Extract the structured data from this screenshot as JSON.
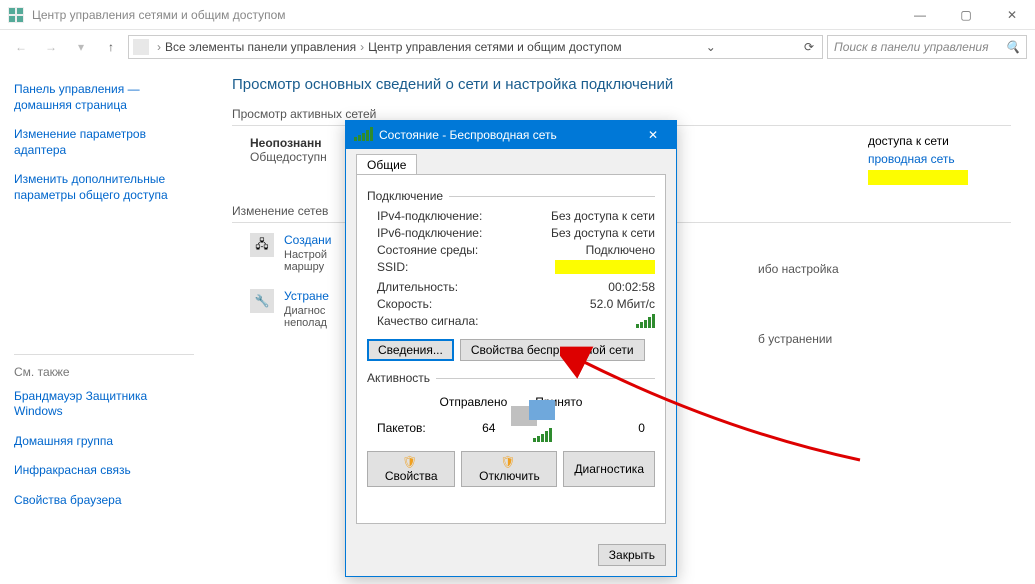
{
  "window": {
    "title": "Центр управления сетями и общим доступом"
  },
  "breadcrumb": {
    "root": "Все элементы панели управления",
    "current": "Центр управления сетями и общим доступом"
  },
  "search": {
    "placeholder": "Поиск в панели управления"
  },
  "sidebar": {
    "items": [
      "Панель управления — домашняя страница",
      "Изменение параметров адаптера",
      "Изменить дополнительные параметры общего доступа"
    ],
    "also_label": "См. также",
    "also": [
      "Брандмауэр Защитника Windows",
      "Домашняя группа",
      "Инфракрасная связь",
      "Свойства браузера"
    ]
  },
  "content": {
    "heading": "Просмотр основных сведений о сети и настройка подключений",
    "active_label": "Просмотр активных сетей",
    "network": {
      "name": "Неопознанн",
      "type_prefix": "Общедоступн"
    },
    "access_row": {
      "label": "доступа к сети"
    },
    "conn_row": {
      "link_suffix": "проводная сеть"
    },
    "change_label": "Изменение сетев",
    "task1": {
      "title": "Создани",
      "desc1": "Настрой",
      "desc2": "маршру"
    },
    "task2": {
      "title": "Устране",
      "desc1": "Диагнос",
      "desc2": "неполад",
      "desc_suffix": "б устранении"
    },
    "setup_suffix": "ибо настройка"
  },
  "dialog": {
    "title": "Состояние - Беспроводная сеть",
    "tab": "Общие",
    "connection_label": "Подключение",
    "rows": {
      "ipv4": {
        "k": "IPv4-подключение:",
        "v": "Без доступа к сети"
      },
      "ipv6": {
        "k": "IPv6-подключение:",
        "v": "Без доступа к сети"
      },
      "media": {
        "k": "Состояние среды:",
        "v": "Подключено"
      },
      "ssid": {
        "k": "SSID:"
      },
      "duration": {
        "k": "Длительность:",
        "v": "00:02:58"
      },
      "speed": {
        "k": "Скорость:",
        "v": "52.0 Мбит/с"
      },
      "signal": {
        "k": "Качество сигнала:"
      }
    },
    "btn_details": "Сведения...",
    "btn_wifi_props": "Свойства беспроводной сети",
    "activity_label": "Активность",
    "sent": "Отправлено",
    "recv": "Принято",
    "packets_label": "Пакетов:",
    "sent_val": "64",
    "recv_val": "0",
    "btn_props": "Свойства",
    "btn_disable": "Отключить",
    "btn_diag": "Диагностика",
    "btn_close": "Закрыть"
  }
}
